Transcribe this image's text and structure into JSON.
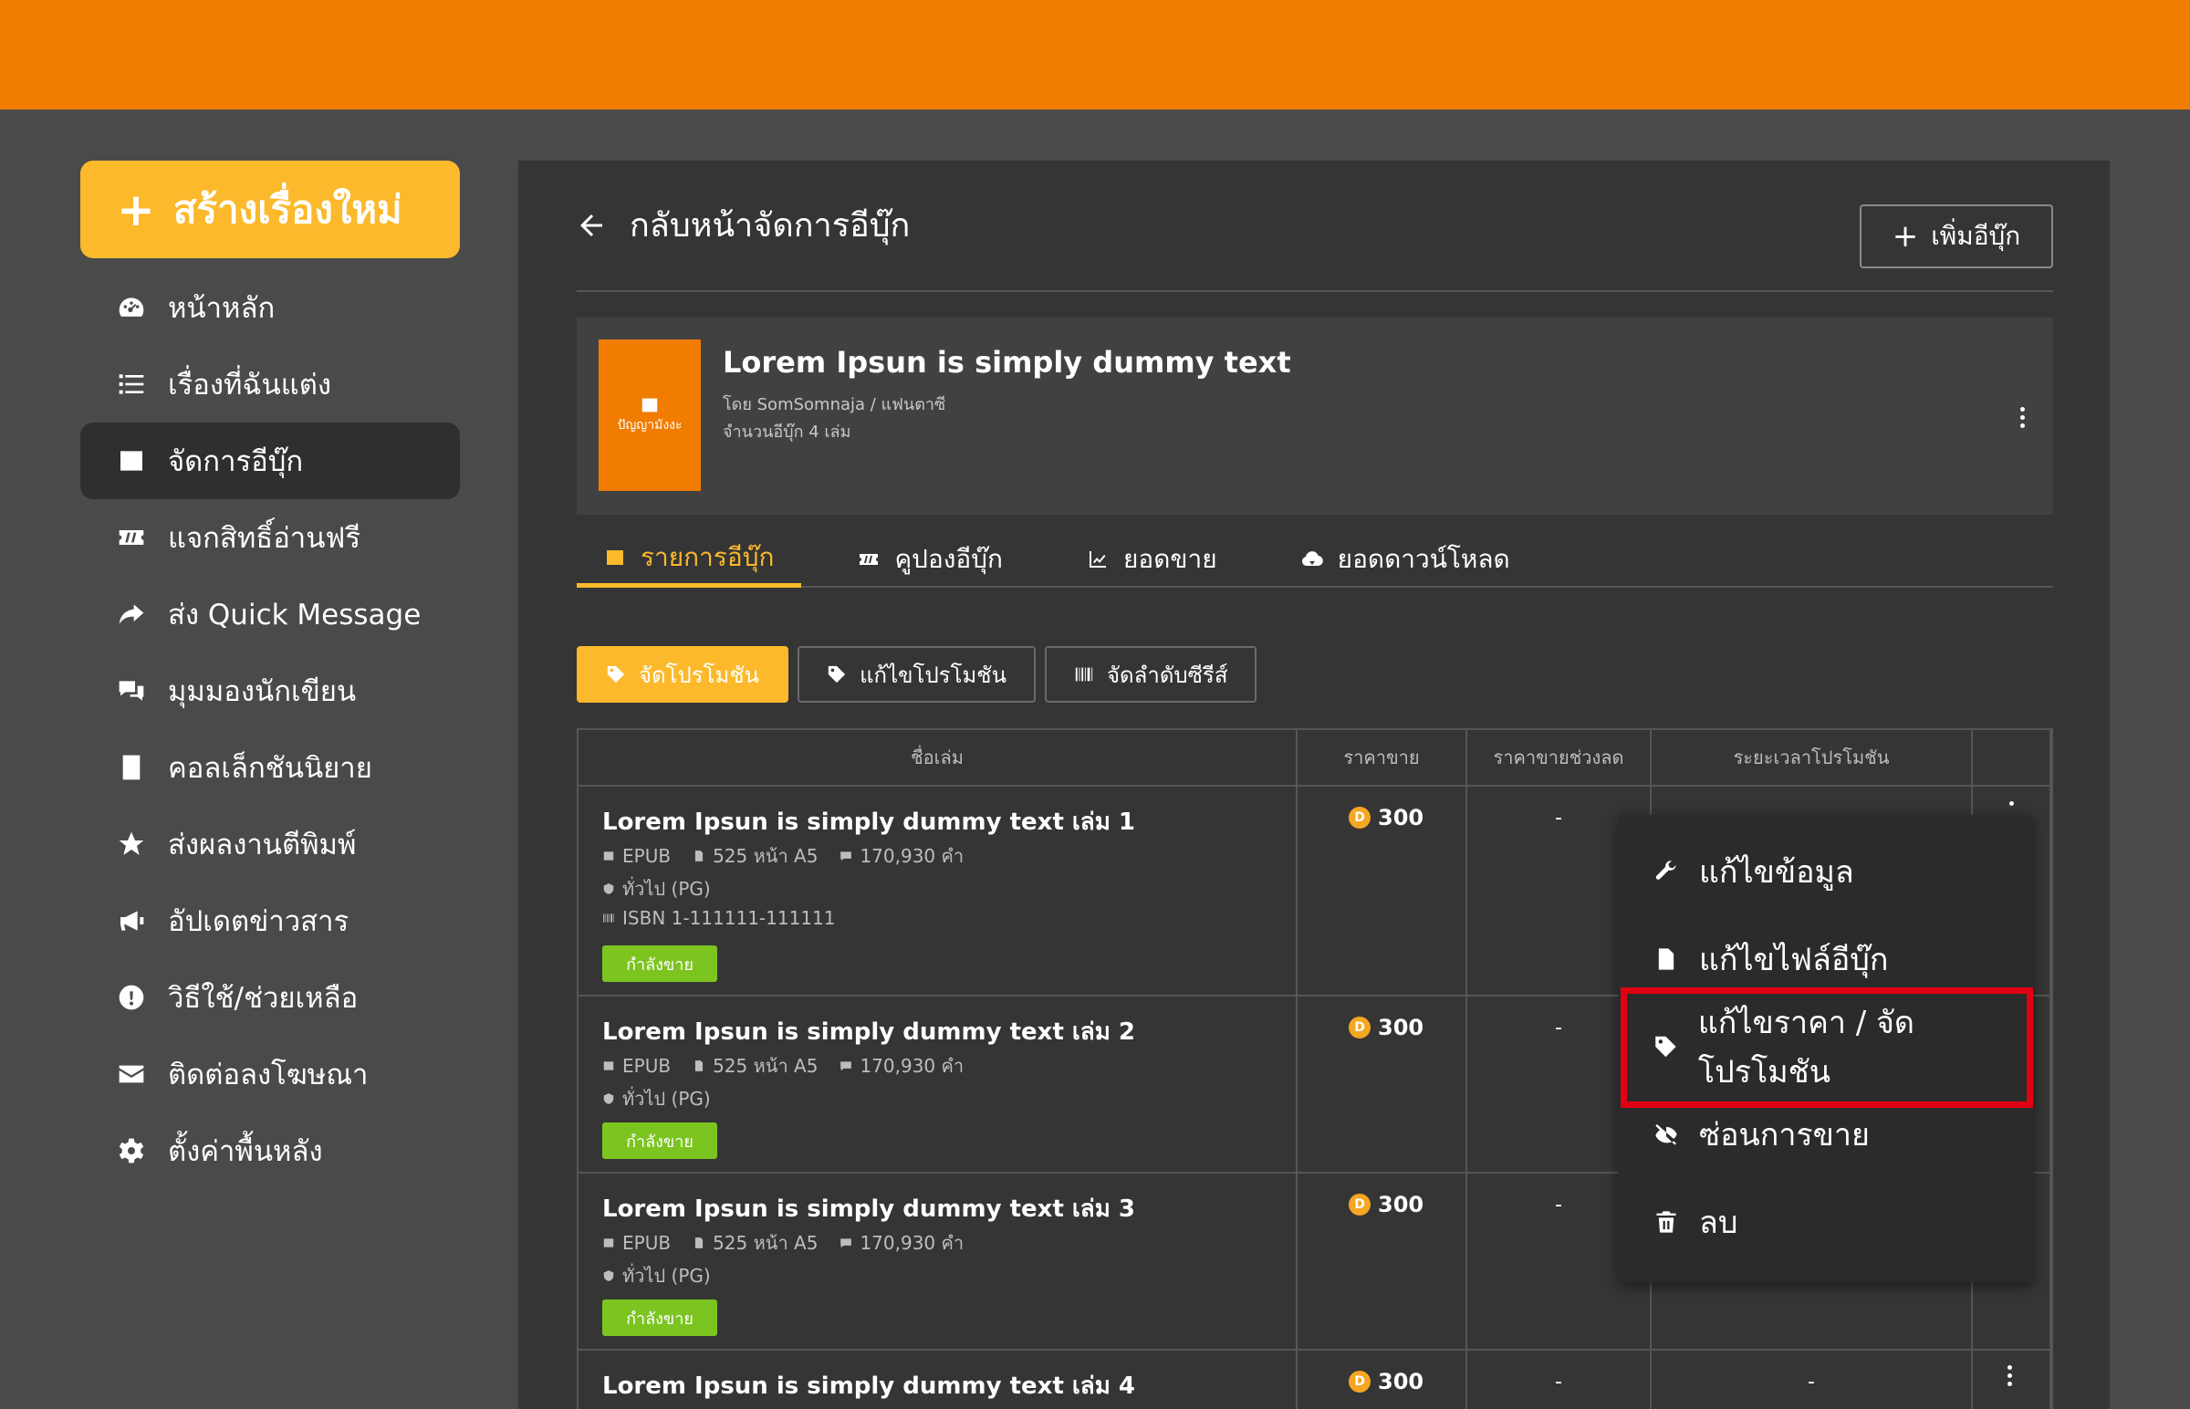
{
  "sidebar": {
    "create_label": "สร้างเรื่องใหม่",
    "items": [
      {
        "label": "หน้าหลัก",
        "icon": "dashboard-icon"
      },
      {
        "label": "เรื่องที่ฉันแต่ง",
        "icon": "list-icon"
      },
      {
        "label": "จัดการอีบุ๊ก",
        "icon": "ebook-icon",
        "active": true
      },
      {
        "label": "แจกสิทธิ์อ่านฟรี",
        "icon": "ticket-icon"
      },
      {
        "label": "ส่ง Quick Message",
        "icon": "share-icon"
      },
      {
        "label": "มุมมองนักเขียน",
        "icon": "comments-icon"
      },
      {
        "label": "คอลเล็กชันนิยาย",
        "icon": "book-icon"
      },
      {
        "label": "ส่งผลงานตีพิมพ์",
        "icon": "star-icon"
      },
      {
        "label": "อัปเดตข่าวสาร",
        "icon": "megaphone-icon"
      },
      {
        "label": "วิธีใช้/ช่วยเหลือ",
        "icon": "alert-icon"
      },
      {
        "label": "ติดต่อลงโฆษณา",
        "icon": "mail-icon"
      },
      {
        "label": "ตั้งค่าพื้นหลัง",
        "icon": "gear-icon"
      }
    ]
  },
  "header": {
    "back_label": "กลับหน้าจัดการอีบุ๊ก",
    "add_label": "เพิ่มอีบุ๊ก"
  },
  "book": {
    "title": "Lorem Ipsun is simply dummy text",
    "by": "โดย SomSomnaja / แฟนตาซี",
    "count": "จำนวนอีบุ๊ก 4 เล่ม",
    "cover_logo": "ปัญญามังงะ"
  },
  "tabs": [
    {
      "label": "รายการอีบุ๊ก",
      "active": true
    },
    {
      "label": "คูปองอีบุ๊ก"
    },
    {
      "label": "ยอดขาย"
    },
    {
      "label": "ยอดดาวน์โหลด"
    }
  ],
  "sub_buttons": {
    "promo": "จัดโปรโมชัน",
    "edit_promo": "แก้ไขโปรโมชัน",
    "series_order": "จัดลำดับซีรีส์"
  },
  "table": {
    "headers": [
      "ชื่อเล่ม",
      "ราคาขาย",
      "ราคาขายช่วงลด",
      "ระยะเวลาโปรโมชัน"
    ],
    "rows": [
      {
        "title": "Lorem Ipsun is simply dummy text เล่ม 1",
        "format": "EPUB",
        "pages": "525 หน้า A5",
        "words": "170,930 คำ",
        "rating": "ทั่วไป (PG)",
        "isbn": "ISBN 1-111111-111111",
        "status": "กำลังขาย",
        "price": "300",
        "discount": "-",
        "period": ""
      },
      {
        "title": "Lorem Ipsun is simply dummy text เล่ม 2",
        "format": "EPUB",
        "pages": "525 หน้า A5",
        "words": "170,930 คำ",
        "rating": "ทั่วไป (PG)",
        "status": "กำลังขาย",
        "price": "300",
        "discount": "-",
        "period": ""
      },
      {
        "title": "Lorem Ipsun is simply dummy text เล่ม 3",
        "format": "EPUB",
        "pages": "525 หน้า A5",
        "words": "170,930 คำ",
        "rating": "ทั่วไป (PG)",
        "status": "กำลังขาย",
        "price": "300",
        "discount": "-",
        "period": ""
      },
      {
        "title": "Lorem Ipsun is simply dummy text เล่ม 4",
        "price": "300",
        "discount": "-",
        "period": "-"
      }
    ]
  },
  "coin_symbol": "D",
  "dropdown": {
    "items": [
      {
        "label": "แก้ไขข้อมูล",
        "icon": "wrench-icon"
      },
      {
        "label": "แก้ไขไฟล์อีบุ๊ก",
        "icon": "file-icon"
      },
      {
        "label": "แก้ไขราคา / จัดโปรโมชัน",
        "icon": "tag-icon"
      },
      {
        "label": "ซ่อนการขาย",
        "icon": "eye-slash-icon"
      },
      {
        "label": "ลบ",
        "icon": "trash-icon"
      }
    ]
  },
  "colors": {
    "topbar": "#f07c00",
    "accent": "#fbb92b",
    "status_green": "#7cc420",
    "highlight": "#e00012"
  }
}
